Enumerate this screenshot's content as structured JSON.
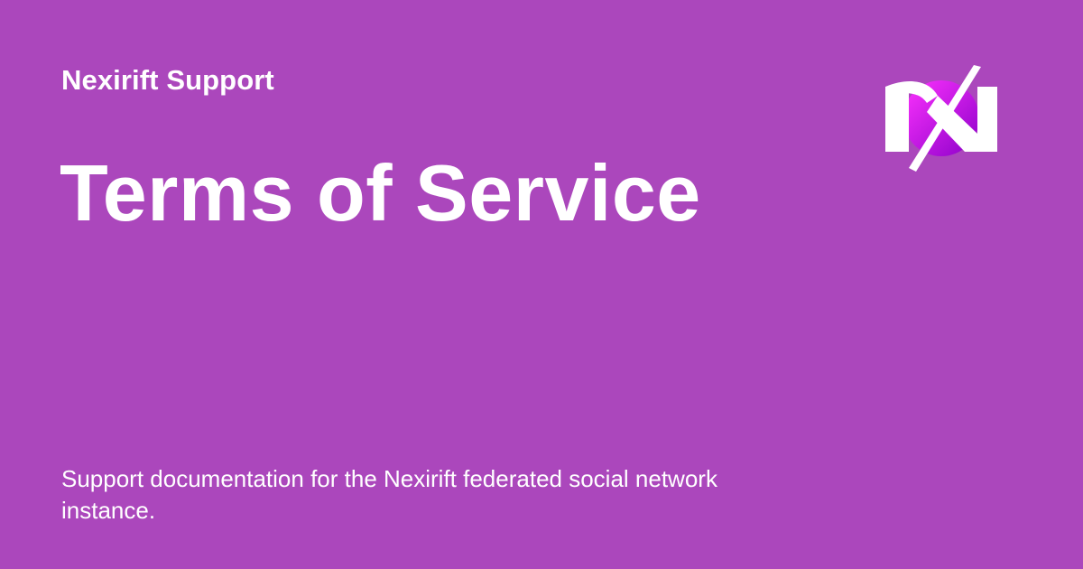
{
  "theme": {
    "background": "#ab47bc",
    "text": "#ffffff",
    "logo_gradient_start": "#ff33ff",
    "logo_gradient_end": "#8a00c8"
  },
  "header": {
    "site_name": "Nexirift Support"
  },
  "main": {
    "title": "Terms of Service",
    "description": "Support documentation for the Nexirift federated social network instance."
  },
  "logo": {
    "icon": "nexirift-logo-icon"
  }
}
